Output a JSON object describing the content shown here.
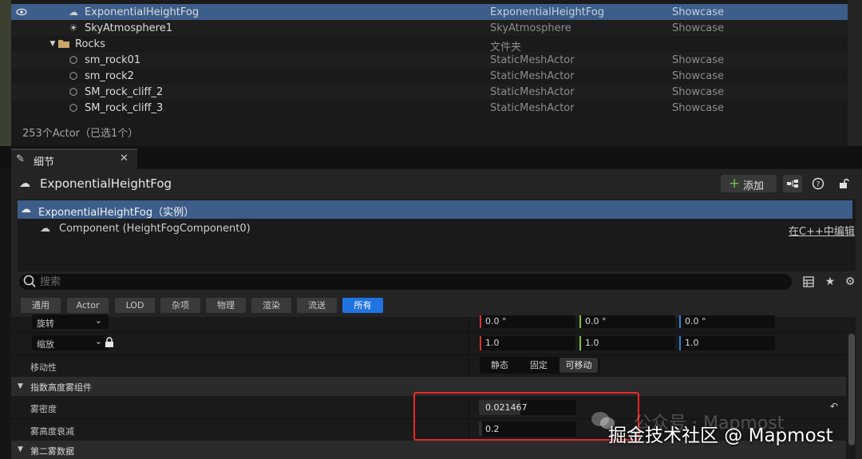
{
  "outliner": {
    "rows": [
      {
        "name": "ExponentialHeightFog",
        "type": "ExponentialHeightFog",
        "layer": "Showcase",
        "icon": "fog-icon",
        "selected": true,
        "visible": true
      },
      {
        "name": "SkyAtmosphere1",
        "type": "SkyAtmosphere",
        "layer": "Showcase",
        "icon": "sky-atmosphere-icon"
      },
      {
        "name": "Rocks",
        "type": "文件夹",
        "layer": "",
        "icon": "folder-icon"
      },
      {
        "name": "sm_rock01",
        "type": "StaticMeshActor",
        "layer": "Showcase",
        "icon": "static-mesh-icon"
      },
      {
        "name": "sm_rock2",
        "type": "StaticMeshActor",
        "layer": "Showcase",
        "icon": "static-mesh-icon"
      },
      {
        "name": "SM_rock_cliff_2",
        "type": "StaticMeshActor",
        "layer": "Showcase",
        "icon": "static-mesh-icon"
      },
      {
        "name": "SM_rock_cliff_3",
        "type": "StaticMeshActor",
        "layer": "Showcase",
        "icon": "static-mesh-icon"
      }
    ],
    "count_text": "253个Actor（已选1个）"
  },
  "details_tab": {
    "label": "细节"
  },
  "actor": {
    "name": "ExponentialHeightFog"
  },
  "toolbar": {
    "add_label": "添加"
  },
  "components": {
    "instance": "ExponentialHeightFog（实例）",
    "child": "Component (HeightFogComponent0)",
    "edit_cpp": "在C++中编辑"
  },
  "search": {
    "placeholder": "搜索"
  },
  "filters": [
    "通用",
    "Actor",
    "LOD",
    "杂项",
    "物理",
    "渲染",
    "流送",
    "所有"
  ],
  "active_filter": "所有",
  "properties": {
    "rotation": {
      "label": "旋转",
      "x": "0.0 °",
      "y": "0.0 °",
      "z": "0.0 °"
    },
    "scale": {
      "label": "缩放",
      "x": "1.0",
      "y": "1.0",
      "z": "1.0"
    },
    "mobility": {
      "label": "移动性",
      "options": [
        "静态",
        "固定",
        "可移动"
      ],
      "selected": "可移动"
    },
    "category_fog": "指数高度雾组件",
    "fog_density": {
      "label": "雾密度",
      "value": "0.021467"
    },
    "fog_falloff": {
      "label": "雾高度衰减",
      "value": "0.2"
    },
    "category_second": "第二雾数据"
  },
  "watermark": {
    "faint": "公众号 · Mapmost",
    "main": "掘金技术社区 @ Mapmost"
  },
  "colors": {
    "selection": "#3d5d8a",
    "accent": "#1f74e2",
    "x_axis": "#d9322c",
    "y_axis": "#7cc43a",
    "z_axis": "#2f7fd8",
    "annotation": "#e8282a"
  }
}
